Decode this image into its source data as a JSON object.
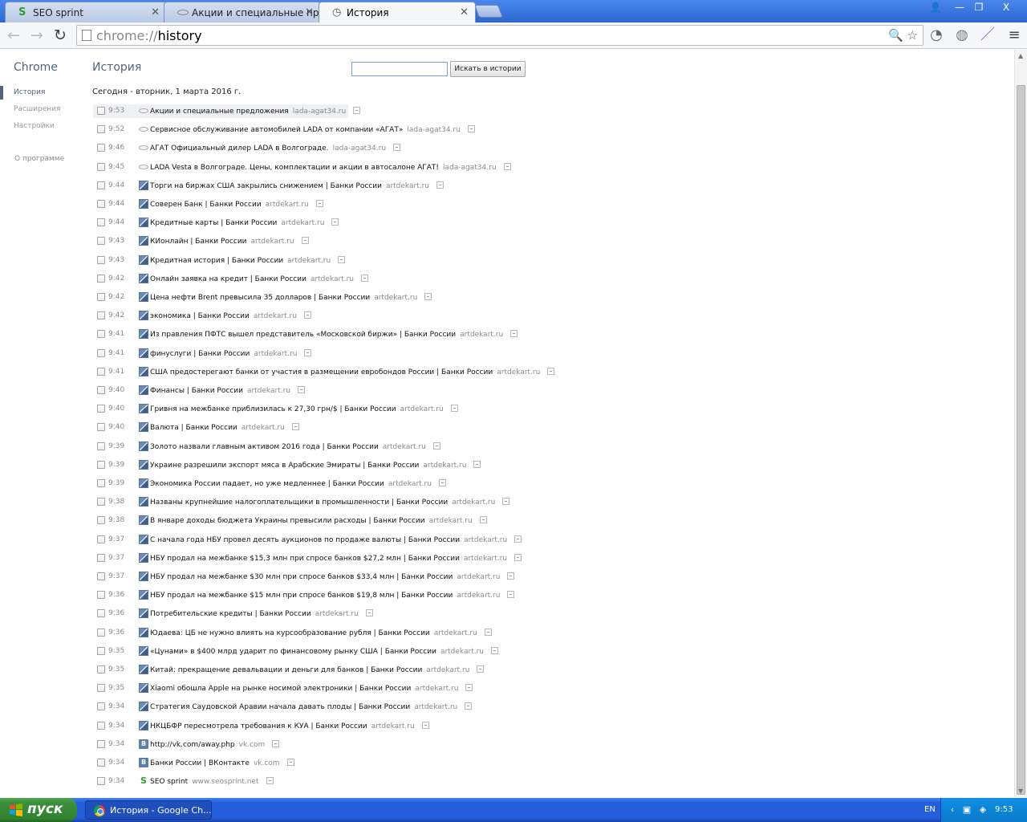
{
  "tabs": [
    {
      "label": "SEO sprint",
      "icon": "seosprint-icon"
    },
    {
      "label": "Акции и специальные пред",
      "icon": "lada-icon"
    },
    {
      "label": "История",
      "icon": "history-icon"
    }
  ],
  "window_controls": {
    "minimize": "—",
    "maximize": "❐",
    "close": "X"
  },
  "address": {
    "scheme": "chrome://",
    "host": "history"
  },
  "sidebar": {
    "brand": "Chrome",
    "items": [
      "История",
      "Расширения",
      "Настройки"
    ],
    "about": "О программе"
  },
  "main": {
    "title": "История",
    "search_button": "Искать в истории",
    "day_header": "Сегодня - вторник, 1 марта 2016 г."
  },
  "entries": [
    {
      "time": "9:53",
      "title": "Акции и специальные предложения",
      "domain": "lada-agat34.ru",
      "icon": "lada"
    },
    {
      "time": "9:52",
      "title": "Сервисное обслуживание автомобилей LADA от компании «АГАТ»",
      "domain": "lada-agat34.ru",
      "icon": "lada"
    },
    {
      "time": "9:46",
      "title": "АГАТ Официальный дилер LADA в Волгограде.",
      "domain": "lada-agat34.ru",
      "icon": "lada"
    },
    {
      "time": "9:45",
      "title": "LADA Vesta в Волгограде. Цены, комплектации и акции в автосалоне АГАТ!",
      "domain": "lada-agat34.ru",
      "icon": "lada"
    },
    {
      "time": "9:44",
      "title": "Торги на биржах США закрылись снижением | Банки России",
      "domain": "artdekart.ru",
      "icon": "art"
    },
    {
      "time": "9:44",
      "title": "Соверен Банк | Банки России",
      "domain": "artdekart.ru",
      "icon": "art"
    },
    {
      "time": "9:44",
      "title": "Кредитные карты | Банки России",
      "domain": "artdekart.ru",
      "icon": "art"
    },
    {
      "time": "9:43",
      "title": "КИонлайн | Банки России",
      "domain": "artdekart.ru",
      "icon": "art"
    },
    {
      "time": "9:43",
      "title": "Кредитная история | Банки России",
      "domain": "artdekart.ru",
      "icon": "art"
    },
    {
      "time": "9:42",
      "title": "Онлайн заявка на кредит | Банки России",
      "domain": "artdekart.ru",
      "icon": "art"
    },
    {
      "time": "9:42",
      "title": "Цена нефти Brent превысила 35 долларов | Банки России",
      "domain": "artdekart.ru",
      "icon": "art"
    },
    {
      "time": "9:42",
      "title": "экономика | Банки России",
      "domain": "artdekart.ru",
      "icon": "art"
    },
    {
      "time": "9:41",
      "title": "Из правления ПФТС вышел представитель «Московской биржи» | Банки России",
      "domain": "artdekart.ru",
      "icon": "art"
    },
    {
      "time": "9:41",
      "title": "финуслуги | Банки России",
      "domain": "artdekart.ru",
      "icon": "art"
    },
    {
      "time": "9:41",
      "title": "США предостерегают банки от участия в размещении евробондов России | Банки России",
      "domain": "artdekart.ru",
      "icon": "art"
    },
    {
      "time": "9:40",
      "title": "Финансы | Банки России",
      "domain": "artdekart.ru",
      "icon": "art"
    },
    {
      "time": "9:40",
      "title": "Гривня на межбанке приблизилась к 27,30 грн/$ | Банки России",
      "domain": "artdekart.ru",
      "icon": "art"
    },
    {
      "time": "9:40",
      "title": "Валюта | Банки России",
      "domain": "artdekart.ru",
      "icon": "art"
    },
    {
      "time": "9:39",
      "title": "Золото назвали главным активом 2016 года | Банки России",
      "domain": "artdekart.ru",
      "icon": "art"
    },
    {
      "time": "9:39",
      "title": "Украине разрешили экспорт мяса в Арабские Эмираты | Банки России",
      "domain": "artdekart.ru",
      "icon": "art"
    },
    {
      "time": "9:39",
      "title": "Экономика России падает, но уже медленнее | Банки России",
      "domain": "artdekart.ru",
      "icon": "art"
    },
    {
      "time": "9:38",
      "title": "Названы крупнейшие налогоплательщики в промышленности | Банки России",
      "domain": "artdekart.ru",
      "icon": "art"
    },
    {
      "time": "9:38",
      "title": "В январе доходы бюджета Украины превысили расходы | Банки России",
      "domain": "artdekart.ru",
      "icon": "art"
    },
    {
      "time": "9:37",
      "title": "С начала года НБУ провел десять аукционов по продаже валюты | Банки России",
      "domain": "artdekart.ru",
      "icon": "art"
    },
    {
      "time": "9:37",
      "title": "НБУ продал на межбанке $15,3 млн при спросе банков $27,2 млн | Банки России",
      "domain": "artdekart.ru",
      "icon": "art"
    },
    {
      "time": "9:37",
      "title": "НБУ продал на межбанке $30 млн при спросе банков $33,4 млн | Банки России",
      "domain": "artdekart.ru",
      "icon": "art"
    },
    {
      "time": "9:36",
      "title": "НБУ продал на межбанке $15 млн при спросе банков $19,8 млн | Банки России",
      "domain": "artdekart.ru",
      "icon": "art"
    },
    {
      "time": "9:36",
      "title": "Потребительские кредиты | Банки России",
      "domain": "artdekart.ru",
      "icon": "art"
    },
    {
      "time": "9:36",
      "title": "Юдаева: ЦБ не нужно влиять на курсообразование рубля | Банки России",
      "domain": "artdekart.ru",
      "icon": "art"
    },
    {
      "time": "9:35",
      "title": "«Цунами» в $400 млрд ударит по финансовому рынку США | Банки России",
      "domain": "artdekart.ru",
      "icon": "art"
    },
    {
      "time": "9:35",
      "title": "Китай: прекращение девальвации и деньги для банков | Банки России",
      "domain": "artdekart.ru",
      "icon": "art"
    },
    {
      "time": "9:35",
      "title": "Xiaomi обошла Apple на рынке носимой электроники | Банки России",
      "domain": "artdekart.ru",
      "icon": "art"
    },
    {
      "time": "9:34",
      "title": "Стратегия Саудовской Аравии начала давать плоды | Банки России",
      "domain": "artdekart.ru",
      "icon": "art"
    },
    {
      "time": "9:34",
      "title": "НКЦБФР пересмотрела требования к КУА | Банки России",
      "domain": "artdekart.ru",
      "icon": "art"
    },
    {
      "time": "9:34",
      "title": "http://vk.com/away.php",
      "domain": "vk.com",
      "icon": "vk"
    },
    {
      "time": "9:34",
      "title": "Банки России | ВКонтакте",
      "domain": "vk.com",
      "icon": "vk"
    },
    {
      "time": "9:34",
      "title": "SEO sprint",
      "domain": "www.seosprint.net",
      "icon": "seo"
    }
  ],
  "taskbar": {
    "start": "пуск",
    "task": "История - Google Ch...",
    "lang": "EN",
    "clock": "9:53"
  }
}
